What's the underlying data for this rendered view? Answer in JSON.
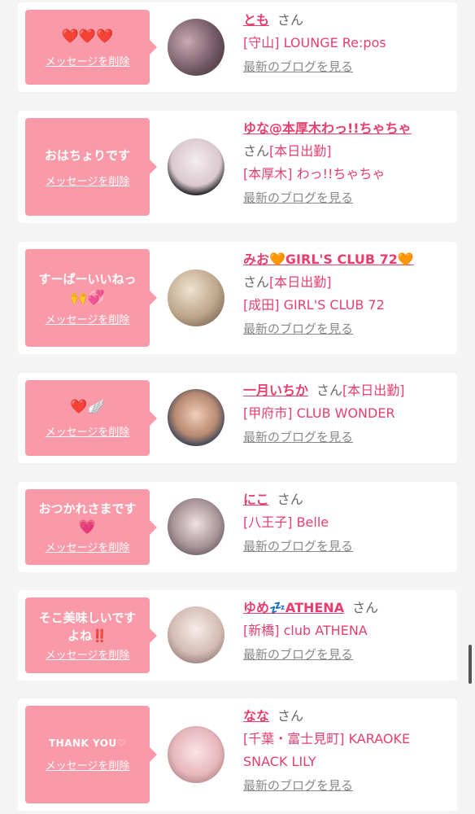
{
  "common": {
    "delete_label": "メッセージを削除",
    "blog_label": "最新のブログを見る",
    "honorific": "さん"
  },
  "items": [
    {
      "message": "",
      "emoji": "❤️❤️❤️",
      "name": "とも",
      "status": "",
      "shop": "[守山] LOUNGE Re:pos",
      "shop2": ""
    },
    {
      "message": "おはちょりです",
      "emoji": "",
      "name": "ゆな@本厚木わっ!!ちゃちゃ",
      "status": "[本日出勤]",
      "shop": "[本厚木] わっ!!ちゃちゃ",
      "shop2": ""
    },
    {
      "message": "すーぱーいいねっ",
      "emoji": "🙌💞",
      "name": "みお🧡GIRL'S CLUB 72🧡",
      "status": "[本日出勤]",
      "shop": "[成田] GIRL'S CLUB 72",
      "shop2": ""
    },
    {
      "message": "",
      "emoji": "❤️🪽",
      "name": "一月いちか",
      "status": "[本日出勤]",
      "shop": "[甲府市] CLUB WONDER",
      "shop2": ""
    },
    {
      "message": "おつかれさまです",
      "emoji": "💗",
      "name": "にこ",
      "status": "",
      "shop": "[八王子] Belle",
      "shop2": ""
    },
    {
      "message": "そこ美味しいです",
      "emoji": "よね‼️",
      "name": "ゆめ💤ATHENA",
      "status": "",
      "shop": "[新橋] club ATHENA",
      "shop2": ""
    },
    {
      "message": "THANK YOU♡",
      "emoji": "",
      "name": "なな",
      "status": "",
      "shop": "[千葉・富士見町] KARAOKE",
      "shop2": "SNACK LILY"
    }
  ],
  "colors": {
    "accent": "#e83e6f",
    "bubble": "#fa9aa8",
    "background": "#f4f4f4"
  }
}
